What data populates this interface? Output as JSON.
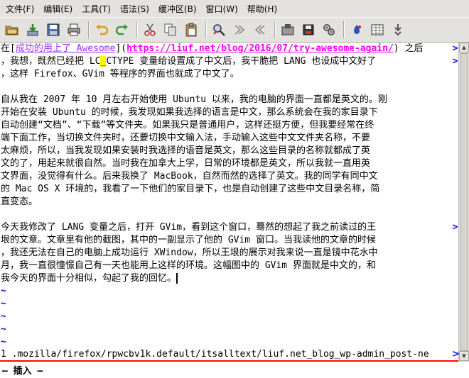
{
  "menu": {
    "file": "文件(F)",
    "edit": "编辑(E)",
    "tools": "工具(T)",
    "syntax": "语法(S)",
    "buffers": "缓冲区(B)",
    "window": "窗口(W)",
    "help": "帮助(H)"
  },
  "toolbar": {
    "icons": [
      "open-folder-icon",
      "download-icon",
      "save-icon",
      "print-icon",
      "undo-icon",
      "redo-icon",
      "cut-icon",
      "copy-icon",
      "paste-icon",
      "find-replace-icon",
      "find-next-icon",
      "find-prev-icon",
      "load-session-icon",
      "save-session-icon",
      "run-script-icon",
      "make-icon",
      "shell-icon",
      "tags-icon"
    ]
  },
  "editor": {
    "line1_pre": "在[",
    "line1_link_text": "成功的用上了 Awesome",
    "line1_mid": "](",
    "line1_url": "https://liuf.net/blog/2016/07/try-awesome-again/",
    "line1_post": ") 之后",
    "line2_pre": "，我想，既然已经把 LC",
    "line2_hl": "_",
    "line2_post": "CTYPE 变量给设置成了中文后，我干脆把 LANG 也设成中文好了",
    "line3": "，这样 Firefox、GVim 等程序的界面也就成了中文了。",
    "line5": "自从我在 2007 年 10 月左右开始使用 Ubuntu 以来，我的电脑的界面一直都是英文的。刚",
    "line6": "开始在安装 Ubuntu 的时候，我发现如果我选择的语言是中文，那么系统会在我的家目录下",
    "line7": "自动创建“文档”、“下载”等文件夹。如果我只是普通用户，这样还挺方便，但我要经常在终",
    "line8": "端下面工作，当切换文件夹时，还要切换中文输入法，手动输入这些中文文件夹名称，不要",
    "line9": "太麻烦，所以，当我发现如果安装时我选择的语音是英文，那么这些目录的名称就都成了英",
    "line10": "文的了，用起来就很自然。当时我在加拿大上学，日常的环境都是英文，所以我就一直用英",
    "line11": "文界面，没觉得有什么。后来我换了 MacBook，自然而然的选择了英文。我的同学有同中文",
    "line12": "的 Mac OS X 环境的，我看了一下他们的家目录下，也是自动创建了这些中文目录名称，简",
    "line13": "直变态。",
    "line15": "今天我修改了 LANG 变量之后，打开 GVim，看到这个窗口，蓦然的想起了我之前读过的王",
    "line16": "垠的文章。文章里有他的截图，其中的一副显示了他的 GVim 窗口。当我读他的文章的时候",
    "line17": "，我还无法在自己的电脑上成功运行 XWindow，所以王垠的展示对我来说一直是镜中花水中",
    "line18": "月，我一直很憧憬自己有一天也能用上这样的环境。这幅图中的 GVim 界面就是中文的，和",
    "line19": "我今天的界面十分相似，勾起了我的回忆。",
    "wrap_marker": ">",
    "tilde": "~"
  },
  "status": {
    "text": "1  .mozilla/firefox/rpwcbv1k.default/itsalltext/liuf.net_blog_wp-admin_post-ne",
    "wrap_marker": ">"
  },
  "cmdline": {
    "mode": "— 插入 —"
  },
  "colors": {
    "menubar_bg": "#e4e2de",
    "editor_bg": "#ffffff",
    "wrap_marker": "#0000ff",
    "tilde": "#0000ff",
    "link_text": "#9b30ff",
    "link_url": "#ff00ff",
    "cursor_highlight": "#ffff00",
    "statusline_border": "#ff0000"
  }
}
